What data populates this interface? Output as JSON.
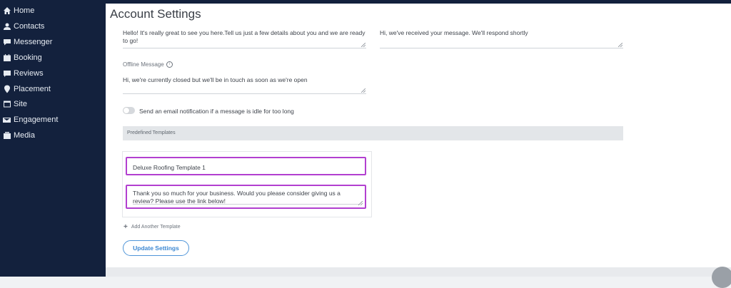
{
  "sidebar": {
    "items": [
      {
        "label": "Home",
        "icon": "home-icon"
      },
      {
        "label": "Contacts",
        "icon": "contacts-icon"
      },
      {
        "label": "Messenger",
        "icon": "messenger-icon"
      },
      {
        "label": "Booking",
        "icon": "booking-icon"
      },
      {
        "label": "Reviews",
        "icon": "reviews-icon"
      },
      {
        "label": "Placement",
        "icon": "placement-icon"
      },
      {
        "label": "Site",
        "icon": "site-icon"
      },
      {
        "label": "Engagement",
        "icon": "engagement-icon"
      },
      {
        "label": "Media",
        "icon": "media-icon"
      }
    ]
  },
  "header": {
    "title": "Account Settings"
  },
  "messages": {
    "welcome_text": "Hello! It's really great to see you here.Tell us just a few details about you and we are ready to go!",
    "received_text": "Hi, we've received your message. We'll respond shortly",
    "offline_label": "Offline Message",
    "offline_text": "Hi, we're currently closed but we'll be in touch as soon as we're open"
  },
  "notification": {
    "label": "Send an email notification if a message is idle for too long",
    "enabled": false
  },
  "templates": {
    "section_title": "Predefined Templates",
    "items": [
      {
        "name": "Deluxe Roofing Template 1",
        "body": "Thank you so much for your business. Would you please consider giving us a review? Please use the link below!"
      }
    ],
    "add_label": "Add Another Template"
  },
  "actions": {
    "update_label": "Update Settings"
  },
  "colors": {
    "sidebar_bg": "#13213d",
    "highlight": "#b23fd0",
    "accent": "#3d88d2"
  }
}
